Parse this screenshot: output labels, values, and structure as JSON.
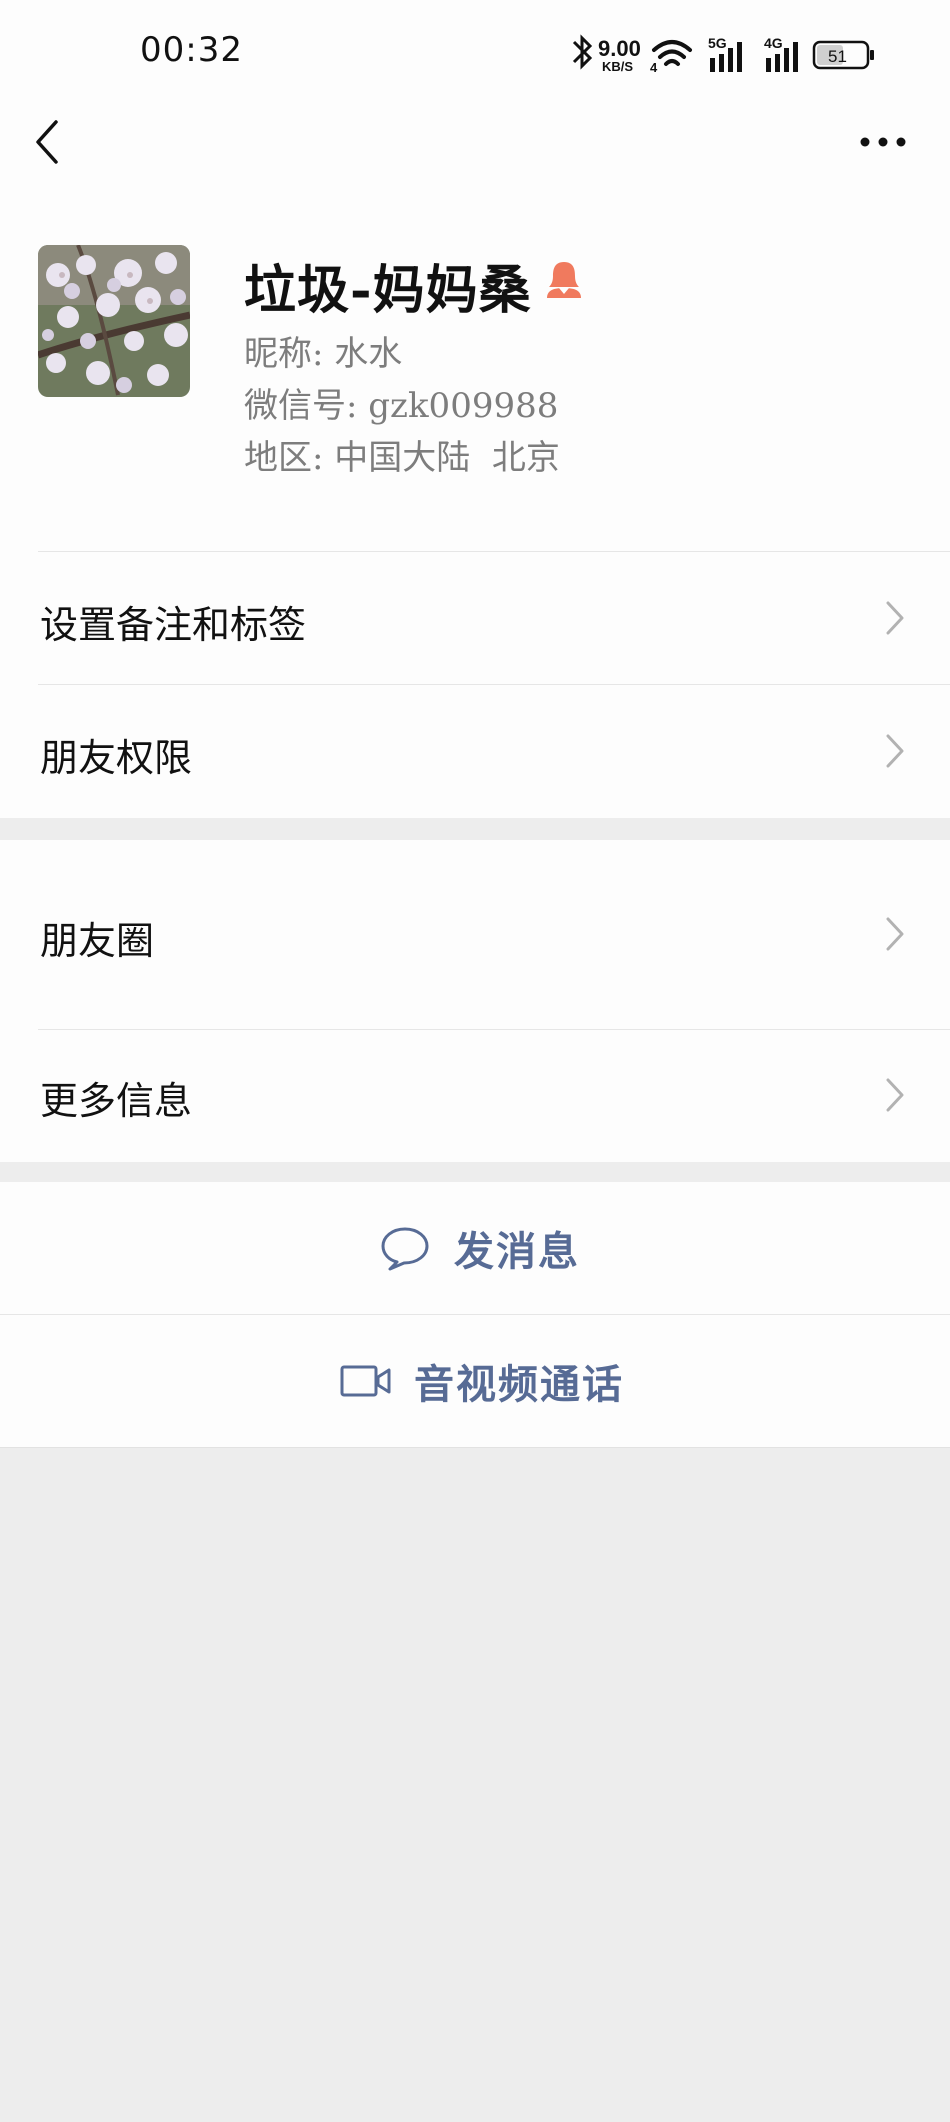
{
  "status_bar": {
    "time": "00:32",
    "speed_value": "9.00",
    "speed_unit": "KB/S",
    "wifi_badge": "4",
    "signal1_label": "5G",
    "signal2_label": "4G",
    "battery": "51"
  },
  "nav": {
    "back_icon": "chevron-left-icon",
    "more_icon": "more-dots-icon"
  },
  "profile": {
    "name": "垃圾-妈妈桑",
    "gender_icon": "female-user-icon",
    "gender_color": "#f07a5e",
    "nickname_label": "昵称:",
    "nickname_value": "水水",
    "wechat_id_label": "微信号:",
    "wechat_id_value": "gzk009988",
    "region_label": "地区:",
    "region_value": "中国大陆  北京"
  },
  "menu": {
    "remark_tags": "设置备注和标签",
    "friend_permissions": "朋友权限",
    "moments": "朋友圈",
    "more_info": "更多信息"
  },
  "actions": {
    "send_message": "发消息",
    "call": "音视频通话",
    "accent_color": "#576b95"
  }
}
